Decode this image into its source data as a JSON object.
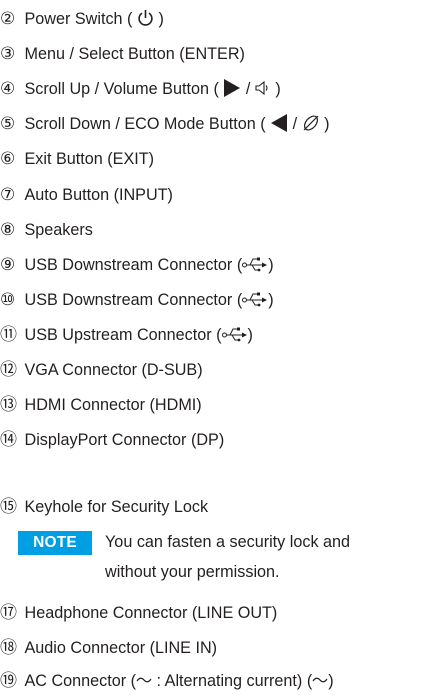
{
  "items": [
    {
      "num": "②",
      "parts": [
        "Power Switch ( ",
        " )"
      ],
      "icon": "power-icon"
    },
    {
      "num": "③",
      "text": "Menu / Select Button (ENTER)"
    },
    {
      "num": "④",
      "parts": [
        "Scroll Up / Volume Button ( ",
        " / ",
        " )"
      ],
      "icons": [
        "right-triangle-icon",
        "speaker-icon"
      ]
    },
    {
      "num": "⑤",
      "parts": [
        "Scroll Down / ECO Mode Button ( ",
        " / ",
        " )"
      ],
      "icons": [
        "left-triangle-icon",
        "eco-leaf-icon"
      ]
    },
    {
      "num": "⑥",
      "text": "Exit Button (EXIT)"
    },
    {
      "num": "⑦",
      "text": "Auto Button (INPUT)"
    },
    {
      "num": "⑧",
      "text": "Speakers"
    },
    {
      "num": "⑨",
      "parts": [
        "USB Downstream Connector (",
        ")"
      ],
      "icon": "usb-icon"
    },
    {
      "num": "⑩",
      "parts": [
        "USB Downstream Connector (",
        ")"
      ],
      "icon": "usb-icon"
    },
    {
      "num": "⑪",
      "parts": [
        "USB Upstream Connector (",
        ")"
      ],
      "icon": "usb-icon"
    },
    {
      "num": "⑫",
      "text": "VGA Connector (D-SUB)"
    },
    {
      "num": "⑬",
      "text": "HDMI Connector (HDMI)"
    },
    {
      "num": "⑭",
      "text": "DisplayPort Connector (DP)"
    },
    {
      "num": "⑮",
      "text": "Keyhole for Security Lock"
    },
    {
      "num": "⑰",
      "text": "Headphone Connector (LINE OUT)"
    },
    {
      "num": "⑱",
      "text": "Audio Connector (LINE IN)"
    },
    {
      "num": "⑲",
      "parts": [
        "AC Connector (",
        " : Alternating current) (",
        ")"
      ],
      "icons": [
        "tilde-icon",
        "tilde-icon"
      ]
    }
  ],
  "note": {
    "badge": "NOTE",
    "line1": "You can fasten a security lock and",
    "line2": "without your permission."
  },
  "colors": {
    "text": "#231f20",
    "note_badge": "#009fe3"
  }
}
